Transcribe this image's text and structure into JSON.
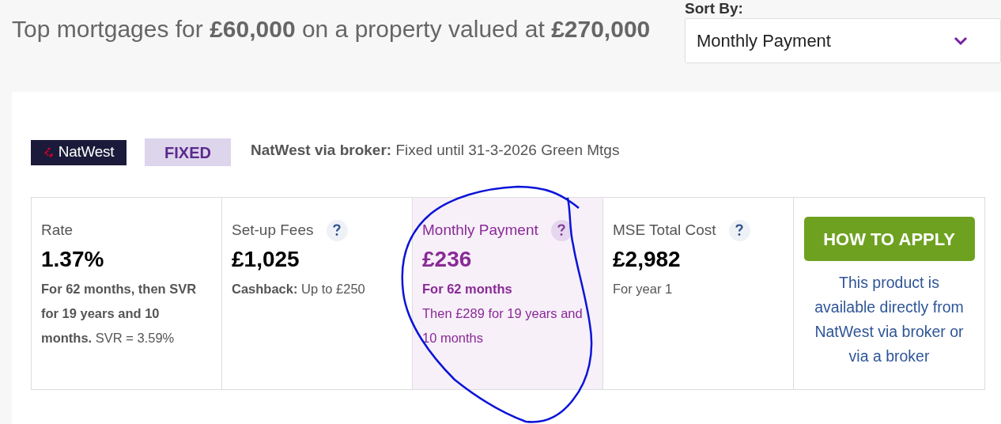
{
  "heading": "Top mortgages for **£60,000** on a property valued at **£270,000**",
  "sort": {
    "label": "Sort By:",
    "value": "Monthly Payment"
  },
  "product": {
    "lender_logo": "NatWest",
    "badge": "FIXED",
    "description": "**NatWest via broker:** Fixed until 31-3-2026 Green Mtgs",
    "columns": [
      {
        "label": "Rate",
        "help": false,
        "highlighted": false,
        "value": "1.37%",
        "notes": [
          "**For 62 months, then SVR for 19 years and 10 months.** SVR = 3.59%"
        ]
      },
      {
        "label": "Set-up Fees",
        "help": true,
        "highlighted": false,
        "value": "£1,025",
        "notes": [
          "**Cashback:** Up to £250"
        ]
      },
      {
        "label": "Monthly Payment",
        "help": true,
        "highlighted": true,
        "value": "£236",
        "notes": [
          "**For 62 months**",
          "Then £289 for 19 years and 10 months"
        ]
      },
      {
        "label": "MSE Total Cost",
        "help": true,
        "highlighted": false,
        "value": "£2,982",
        "notes": [
          "For year 1"
        ]
      }
    ],
    "apply": {
      "button": "HOW TO APPLY",
      "info": "This product is available directly from NatWest via broker or via a broker"
    }
  }
}
